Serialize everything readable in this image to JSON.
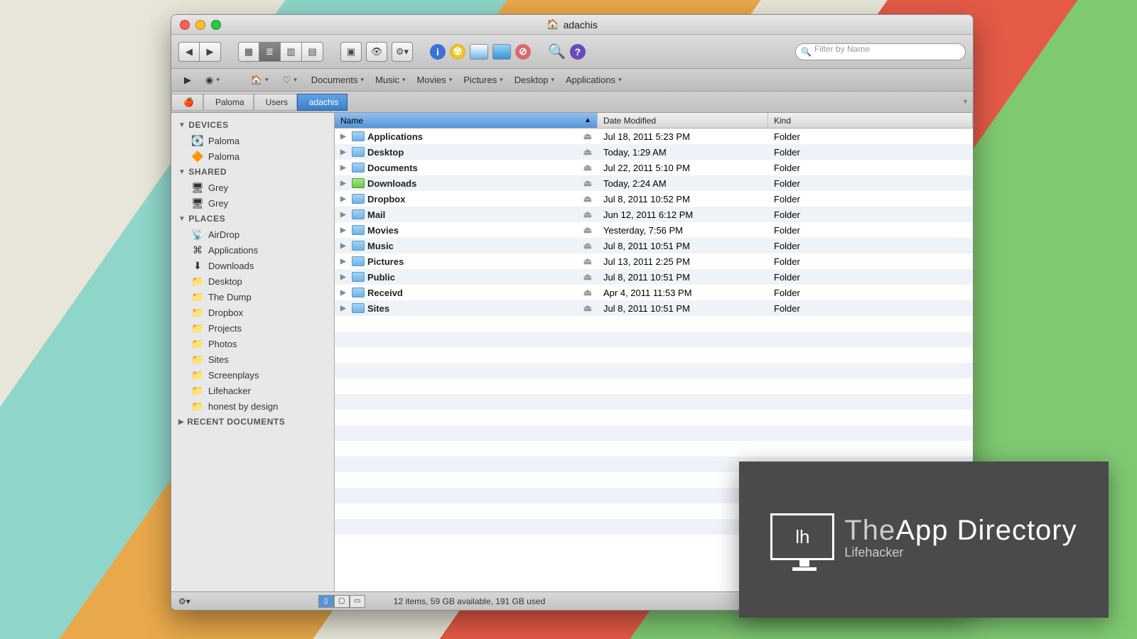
{
  "window": {
    "title": "adachis"
  },
  "toolbar": {
    "search_placeholder": "Filter by Name"
  },
  "favorites": [
    "Documents",
    "Music",
    "Movies",
    "Pictures",
    "Desktop",
    "Applications"
  ],
  "pathbar": [
    "Paloma",
    "Users",
    "adachis"
  ],
  "sidebar": {
    "devices_label": "DEVICES",
    "devices": [
      "Paloma",
      "Paloma"
    ],
    "shared_label": "SHARED",
    "shared": [
      "Grey",
      "Grey"
    ],
    "places_label": "PLACES",
    "places": [
      "AirDrop",
      "Applications",
      "Downloads",
      "Desktop",
      "The Dump",
      "Dropbox",
      "Projects",
      "Photos",
      "Sites",
      "Screenplays",
      "Lifehacker",
      "honest by design"
    ],
    "recent_label": "RECENT DOCUMENTS"
  },
  "columns": {
    "name": "Name",
    "date": "Date Modified",
    "kind": "Kind"
  },
  "files": [
    {
      "name": "Applications",
      "date": "Jul 18, 2011 5:23 PM",
      "kind": "Folder",
      "icon": "blue"
    },
    {
      "name": "Desktop",
      "date": "Today, 1:29 AM",
      "kind": "Folder",
      "icon": "blue"
    },
    {
      "name": "Documents",
      "date": "Jul 22, 2011 5:10 PM",
      "kind": "Folder",
      "icon": "blue"
    },
    {
      "name": "Downloads",
      "date": "Today, 2:24 AM",
      "kind": "Folder",
      "icon": "green"
    },
    {
      "name": "Dropbox",
      "date": "Jul 8, 2011 10:52 PM",
      "kind": "Folder",
      "icon": "blue"
    },
    {
      "name": "Mail",
      "date": "Jun 12, 2011 6:12 PM",
      "kind": "Folder",
      "icon": "blue"
    },
    {
      "name": "Movies",
      "date": "Yesterday, 7:56 PM",
      "kind": "Folder",
      "icon": "blue"
    },
    {
      "name": "Music",
      "date": "Jul 8, 2011 10:51 PM",
      "kind": "Folder",
      "icon": "blue"
    },
    {
      "name": "Pictures",
      "date": "Jul 13, 2011 2:25 PM",
      "kind": "Folder",
      "icon": "blue"
    },
    {
      "name": "Public",
      "date": "Jul 8, 2011 10:51 PM",
      "kind": "Folder",
      "icon": "blue"
    },
    {
      "name": "Receivd",
      "date": "Apr 4, 2011 11:53 PM",
      "kind": "Folder",
      "icon": "blue"
    },
    {
      "name": "Sites",
      "date": "Jul 8, 2011 10:51 PM",
      "kind": "Folder",
      "icon": "blue"
    }
  ],
  "statusbar": "12 items, 59 GB available, 191 GB used",
  "badge": {
    "prefix": "The",
    "main": "App Directory",
    "sub": "Lifehacker",
    "icon_text": "lh"
  }
}
